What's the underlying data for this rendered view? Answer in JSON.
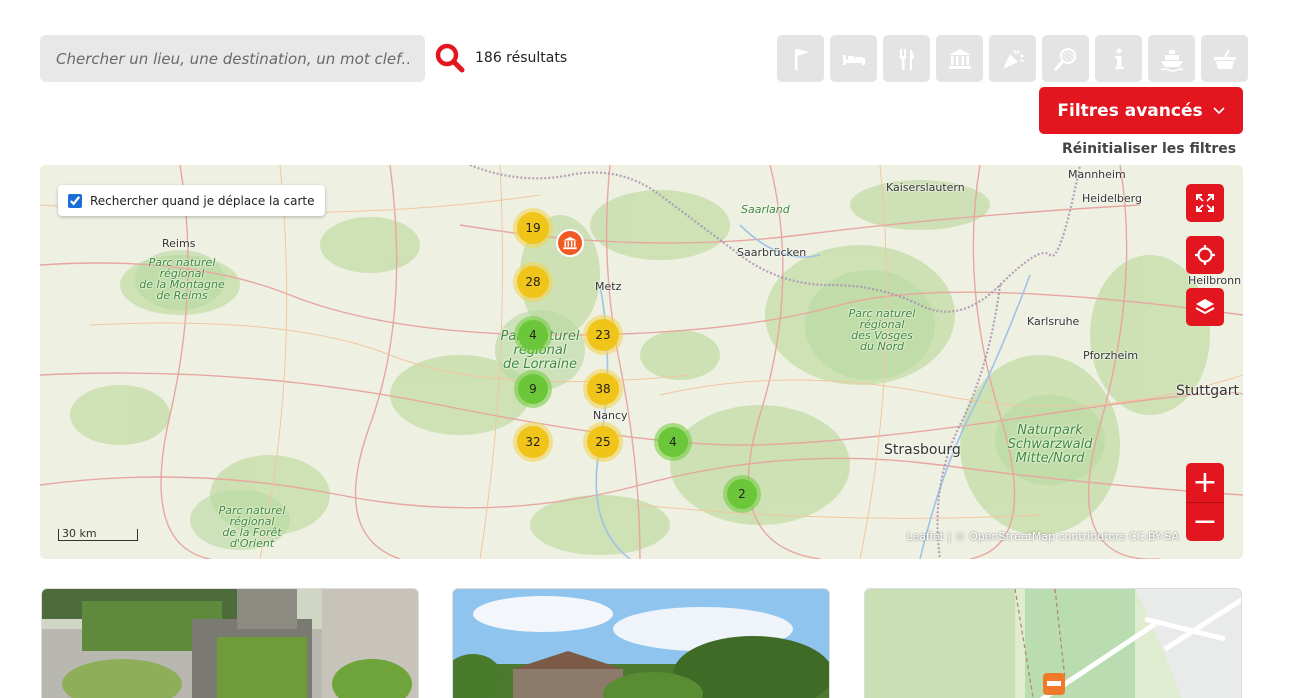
{
  "search": {
    "placeholder": "Chercher un lieu, une destination, un mot clef…",
    "results": "186 résultats"
  },
  "categories": [
    {
      "icon": "flag-icon"
    },
    {
      "icon": "bed-icon"
    },
    {
      "icon": "restaurant-icon"
    },
    {
      "icon": "museum-icon"
    },
    {
      "icon": "party-icon"
    },
    {
      "icon": "tennis-icon"
    },
    {
      "icon": "info-icon"
    },
    {
      "icon": "boat-icon"
    },
    {
      "icon": "basket-icon"
    }
  ],
  "filters": {
    "advanced_label": "Filtres avancés",
    "reset_label": "Réinitialiser les filtres"
  },
  "map": {
    "checkbox_label": "Rechercher quand je déplace la carte",
    "checkbox_checked": true,
    "clusters": [
      {
        "count": "19",
        "color": "yellow"
      },
      {
        "count": "28",
        "color": "yellow"
      },
      {
        "count": "4",
        "color": "green"
      },
      {
        "count": "23",
        "color": "yellow"
      },
      {
        "count": "9",
        "color": "green"
      },
      {
        "count": "38",
        "color": "yellow"
      },
      {
        "count": "32",
        "color": "yellow"
      },
      {
        "count": "25",
        "color": "yellow"
      },
      {
        "count": "4",
        "color": "green"
      },
      {
        "count": "2",
        "color": "green"
      }
    ],
    "places": {
      "reims": "Reims",
      "metz": "Metz",
      "nancy": "Nancy",
      "strasbourg": "Strasbourg",
      "saarbrucken": "Saarbrücken",
      "saarland": "Saarland",
      "kaiserslautern": "Kaiserslautern",
      "mannheim": "Mannheim",
      "heidelberg": "Heidelberg",
      "heilbronn": "Heilbronn",
      "karlsruhe": "Karlsruhe",
      "pforzheim": "Pforzheim",
      "stuttgart": "Stuttgart"
    },
    "parks": {
      "reims_1": "Parc naturel",
      "reims_2": "régional",
      "reims_3": "de la Montagne",
      "reims_4": "de Reims",
      "lorraine_1": "Parc naturel",
      "lorraine_2": "régional",
      "lorraine_3": "de Lorraine",
      "vosges_1": "Parc naturel",
      "vosges_2": "régional",
      "vosges_3": "des Vosges",
      "vosges_4": "du Nord",
      "orient_1": "Parc naturel",
      "orient_2": "régional",
      "orient_3": "de la Forêt",
      "orient_4": "d'Orient",
      "schwarz_1": "Naturpark",
      "schwarz_2": "Schwarzwald",
      "schwarz_3": "Mitte/Nord"
    },
    "scale_label": "30 km",
    "attribution": "Leaflet | © OpenStreetMap contributors CC-BY-SA",
    "accent": "#e3161f"
  }
}
